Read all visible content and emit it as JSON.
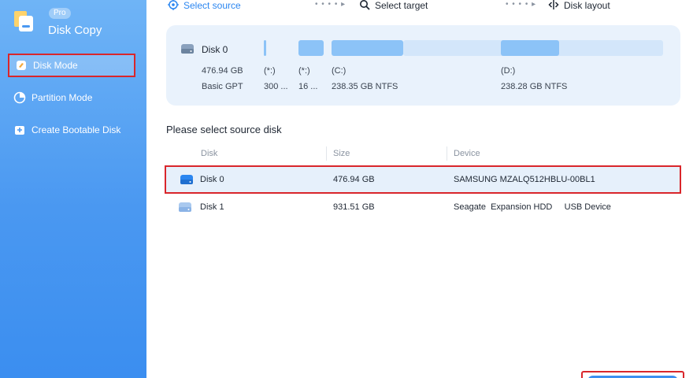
{
  "app": {
    "title": "Disk Copy",
    "badge": "Pro"
  },
  "sidebar": {
    "items": [
      {
        "label": "Disk Mode",
        "icon": "disk-mode-icon",
        "active": true
      },
      {
        "label": "Partition Mode",
        "icon": "pie-chart-icon",
        "active": false
      },
      {
        "label": "Create Bootable Disk",
        "icon": "bootable-disk-icon",
        "active": false
      }
    ]
  },
  "steps": [
    {
      "label": "Select source",
      "icon": "target-icon",
      "active": true
    },
    {
      "label": "Select target",
      "icon": "search-icon",
      "active": false
    },
    {
      "label": "Disk layout",
      "icon": "layout-icon",
      "active": false
    }
  ],
  "disk_panel": {
    "name": "Disk 0",
    "size": "476.94 GB",
    "type": "Basic GPT",
    "partitions": [
      {
        "label": "(*:)",
        "detail": "300 ..."
      },
      {
        "label": "(*:)",
        "detail": "16 ..."
      },
      {
        "label": "(C:)",
        "detail": "238.35 GB NTFS"
      },
      {
        "label": "(D:)",
        "detail": "238.28 GB NTFS"
      }
    ]
  },
  "section_title": "Please select source disk",
  "table": {
    "headers": [
      "Disk",
      "Size",
      "Device"
    ],
    "rows": [
      {
        "disk": "Disk 0",
        "size": "476.94 GB",
        "device": "SAMSUNG MZALQ512HBLU-00BL1",
        "selected": true
      },
      {
        "disk": "Disk 1",
        "size": "931.51 GB",
        "device": "Seagate  Expansion HDD     USB Device",
        "selected": false
      }
    ]
  },
  "colors": {
    "accent": "#2b86f0",
    "sidebar_top": "#6fb4f6",
    "sidebar_bottom": "#3b8ef0",
    "partition_bar": "#8cc3f7",
    "partition_bar_light": "#d3e6fa",
    "highlight_border": "#d9262b"
  }
}
